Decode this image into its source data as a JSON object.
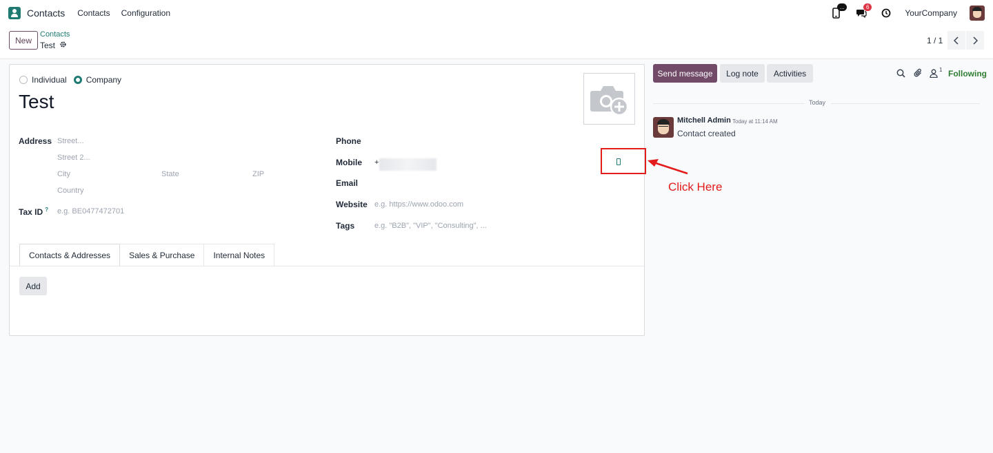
{
  "navbar": {
    "app_name": "Contacts",
    "menus": [
      "Contacts",
      "Configuration"
    ],
    "messages_badge": "6",
    "sms_badge": "...",
    "company": "YourCompany"
  },
  "control_panel": {
    "new_label": "New",
    "breadcrumb_parent": "Contacts",
    "breadcrumb_current": "Test",
    "pager": "1 / 1"
  },
  "form": {
    "company_type": {
      "individual_label": "Individual",
      "company_label": "Company",
      "selected": "Company"
    },
    "name": "Test",
    "address": {
      "label": "Address",
      "street_ph": "Street...",
      "street2_ph": "Street 2...",
      "city_ph": "City",
      "state_ph": "State",
      "zip_ph": "ZIP",
      "country_ph": "Country"
    },
    "tax_id": {
      "label": "Tax ID",
      "help": "?",
      "placeholder": "e.g. BE0477472701"
    },
    "phone_label": "Phone",
    "mobile": {
      "label": "Mobile",
      "value": "+"
    },
    "email_label": "Email",
    "website": {
      "label": "Website",
      "placeholder": "e.g. https://www.odoo.com"
    },
    "tags": {
      "label": "Tags",
      "placeholder": "e.g. \"B2B\", \"VIP\", \"Consulting\", ..."
    },
    "tabs": [
      "Contacts & Addresses",
      "Sales & Purchase",
      "Internal Notes"
    ],
    "active_tab": "Contacts & Addresses",
    "add_label": "Add"
  },
  "chatter": {
    "send_message": "Send message",
    "log_note": "Log note",
    "activities": "Activities",
    "follower_count": "1",
    "following": "Following",
    "date_separator": "Today",
    "message": {
      "author": "Mitchell Admin",
      "time": "Today at 11:14 AM",
      "body": "Contact created"
    }
  },
  "annotation": {
    "text": "Click Here",
    "color": "#e31b1b"
  },
  "colors": {
    "brand": "#714b67",
    "accent": "#1f7a72",
    "following": "#2e7d32"
  }
}
